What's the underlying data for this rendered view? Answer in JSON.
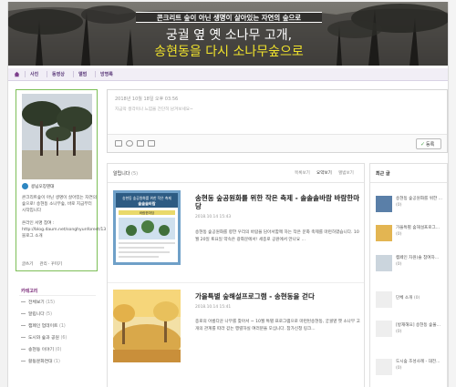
{
  "banner": {
    "line1": "콘크리트 숲이 아닌 생명이 살아있는 자연의 숲으로",
    "line2": "궁궐 옆 옛 소나무 고개,",
    "line3": "송현동을 다시 소나무숲으로"
  },
  "nav": {
    "home_icon": "home-icon",
    "items": [
      "사진",
      "동영상",
      "앨범",
      "방명록"
    ]
  },
  "profile": {
    "name": "콩닙오징덴대",
    "desc": "콘크리트숲이 아닌 생명이 살아있는 자연의 숲으로! 송현동 소나무숲, 바로 지금부터 시작입니다",
    "online_label": "온라인 서명 참여 : http://blog.daum.net/songhyunforest/13",
    "followers": "블로그 소개",
    "write": "글쓰기",
    "manage": "관리 · 꾸미기"
  },
  "categories": {
    "title": "카테고리",
    "items": [
      {
        "label": "전체보기",
        "count": "(15)"
      },
      {
        "label": "알립니다",
        "count": "(5)"
      },
      {
        "label": "캠페인 업데이트",
        "count": "(1)"
      },
      {
        "label": "도시와 숲과 공원",
        "count": "(6)"
      },
      {
        "label": "송현동 이야기",
        "count": "(0)"
      },
      {
        "label": "활동문화연대",
        "count": "(1)"
      }
    ]
  },
  "write_box": {
    "date": "2018년 10월 18일 오후 03:56",
    "placeholder": "지금막 생각이나 느낌을 간단히 남겨보세요~",
    "submit": "등록"
  },
  "posts": {
    "header": "알립니다",
    "count": "(5)",
    "sort": [
      "목록보기",
      "요약보기",
      "앨범보기"
    ],
    "items": [
      {
        "title": "송현동 숲공원화를 위한 작은 축제 - 솔솔솔바람 바람한마당",
        "date": "2018.10.14 15:43",
        "body": "송현동 숲공원화를 향한 우리의 바람을 담아서함께 하는 작은 문화 축제를 마련하였습니다. 10월 20일 토요일 약속은 광화문에서! 세종로 공원에서 만나요 ..."
      },
      {
        "title": "가을특별 숲해설프로그램 - 송현동을 걷다",
        "date": "2018.10.14 15:41",
        "body": "종로의 아름다운 나무를 찾아서 ~ 10월 특별 프로그램으로 마련된송현동, 궁궐옆 옛 소나무 고개의 관계를 따라 걷는 행렬하실 여러분을 모십니다. 참가신청 링크..."
      }
    ],
    "thumb1": {
      "line1": "송현동 숲공원화를 위한 작은 축제",
      "line2": "솔솔솔바람",
      "line3": "바람한마당"
    }
  },
  "recent": {
    "title": "최근 글",
    "items": [
      {
        "text": "송현동 숲공원화를 위한 ...",
        "count": "(0)"
      },
      {
        "text": "가을특별 숲해설프로그...",
        "count": "(0)"
      },
      {
        "text": "캠페인 차원(솔 참여자...",
        "count": "(0)"
      },
      {
        "text": "단체 소개",
        "count": "(0)"
      },
      {
        "text": "[방재해요] 송현동 숲울...",
        "count": "(0)"
      },
      {
        "text": "도시숲 조성사례 - 대전...",
        "count": "(0)"
      }
    ]
  }
}
